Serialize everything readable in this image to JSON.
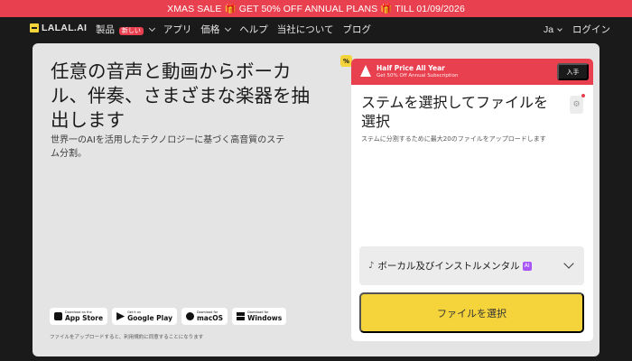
{
  "promo": {
    "text": "XMAS SALE 🎁 GET 50% OFF ANNUAL PLANS 🎁 TILL 01/09/2026"
  },
  "nav": {
    "logo": "LALAL.AI",
    "items": [
      {
        "label": "製品",
        "badge": "新しい",
        "dropdown": true
      },
      {
        "label": "アプリ"
      },
      {
        "label": "価格",
        "dropdown": true
      },
      {
        "label": "ヘルプ"
      },
      {
        "label": "当社について"
      },
      {
        "label": "ブログ"
      }
    ],
    "language": "Ja",
    "login": "ログイン"
  },
  "hero": {
    "title": "任意の音声と動画からボーカル、伴奏、さまざまな楽器を抽出します",
    "subtitle": "世界一のAIを活用したテクノロジーに基づく高音質のステム分割。",
    "stores": [
      {
        "small": "Download on the",
        "big": "App Store",
        "icon": "apple-icon"
      },
      {
        "small": "Get it on",
        "big": "Google Play",
        "icon": "google-play-icon"
      },
      {
        "small": "Download for",
        "big": "macOS",
        "icon": "macos-icon"
      },
      {
        "small": "Download for",
        "big": "Windows",
        "icon": "windows-icon"
      }
    ],
    "disclaimer": "ファイルをアップロードすると、利用規約に同意することになります"
  },
  "panel": {
    "discount_badge": "%",
    "banner": {
      "title": "Half Price All Year",
      "subtitle": "Get 50% Off Annual Subscription",
      "button": "入手"
    },
    "title": "ステムを選択してファイルを選択",
    "subtitle": "ステムに分割するために最大20のファイルをアップロードします",
    "stem_select": {
      "value": "ボーカル及びインストルメンタル",
      "ai_badge": "AI"
    },
    "select_button": "ファイルを選択"
  },
  "colors": {
    "accent_red": "#e9404f",
    "accent_yellow": "#f5d33a",
    "background": "#1a1a1a",
    "hero_bg": "#e4e4e4"
  }
}
